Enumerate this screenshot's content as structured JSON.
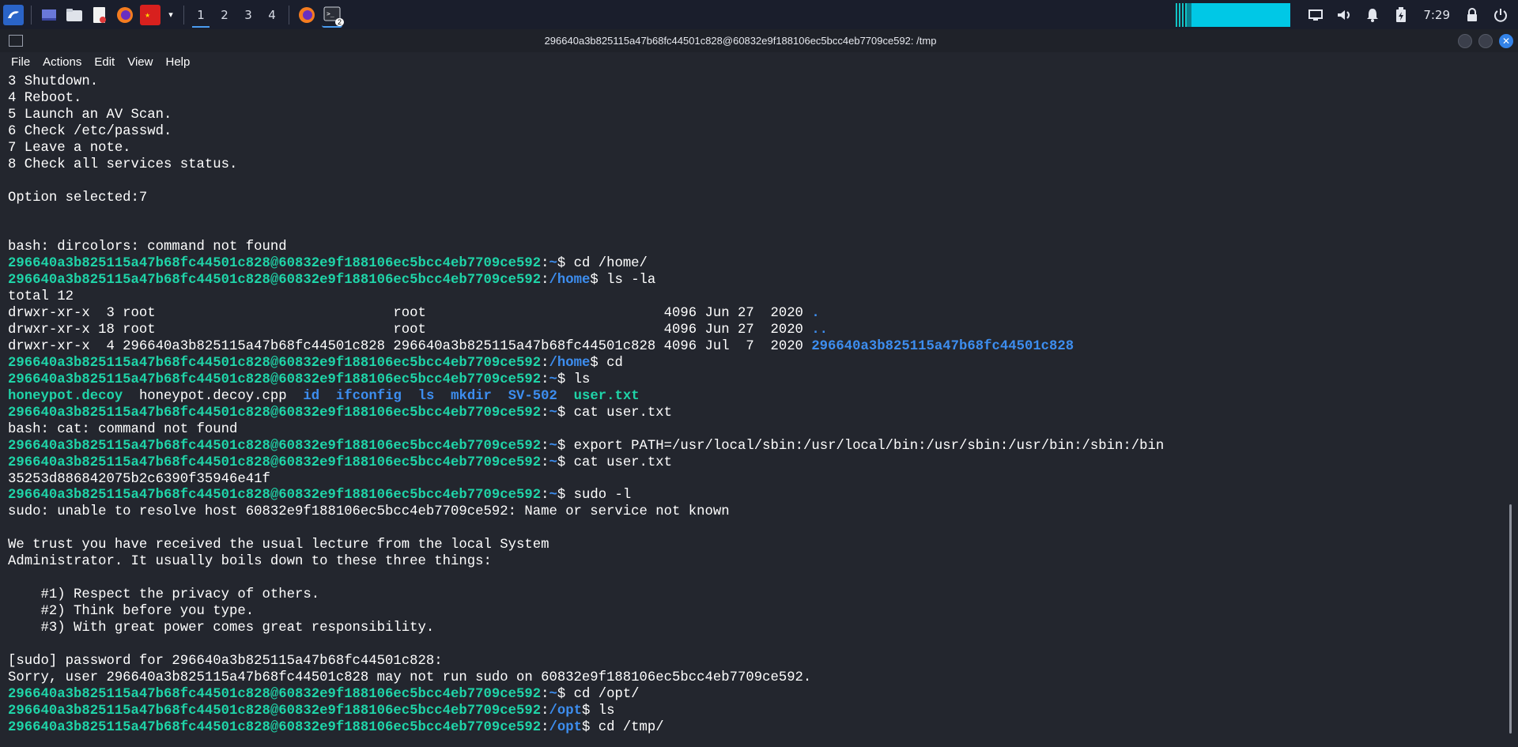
{
  "taskbar": {
    "workspaces": [
      "1",
      "2",
      "3",
      "4"
    ],
    "active_workspace": 0,
    "terminal_badge": "2",
    "clock": "7:29",
    "accent_color": "#4a9cf0"
  },
  "window": {
    "title": "296640a3b825115a47b68fc44501c828@60832e9f188106ec5bcc4eb7709ce592: /tmp"
  },
  "menubar": {
    "items": [
      "File",
      "Actions",
      "Edit",
      "View",
      "Help"
    ]
  },
  "terminal": {
    "user": "296640a3b825115a47b68fc44501c828",
    "host": "60832e9f188106ec5bcc4eb7709ce592",
    "prompt_user_color": "#1fd4a8",
    "prompt_path_color": "#3d8ef0",
    "text_color": "#ffffff",
    "background": "#23262e",
    "lines": [
      {
        "type": "out",
        "text": "3 Shutdown."
      },
      {
        "type": "out",
        "text": "4 Reboot."
      },
      {
        "type": "out",
        "text": "5 Launch an AV Scan."
      },
      {
        "type": "out",
        "text": "6 Check /etc/passwd."
      },
      {
        "type": "out",
        "text": "7 Leave a note."
      },
      {
        "type": "out",
        "text": "8 Check all services status."
      },
      {
        "type": "out",
        "text": ""
      },
      {
        "type": "out",
        "text": "Option selected:7"
      },
      {
        "type": "out",
        "text": ""
      },
      {
        "type": "out",
        "text": ""
      },
      {
        "type": "out",
        "text": "bash: dircolors: command not found"
      },
      {
        "type": "prompt",
        "user": "296640a3b825115a47b68fc44501c828@60832e9f188106ec5bcc4eb7709ce592",
        "path": "~",
        "cmd": "cd /home/"
      },
      {
        "type": "prompt",
        "user": "296640a3b825115a47b68fc44501c828@60832e9f188106ec5bcc4eb7709ce592",
        "path": "/home",
        "cmd": "ls -la"
      },
      {
        "type": "out",
        "text": "total 12"
      },
      {
        "type": "ls",
        "text": "drwxr-xr-x  3 root                             root                             4096 Jun 27  2020 ",
        "name": "."
      },
      {
        "type": "ls",
        "text": "drwxr-xr-x 18 root                             root                             4096 Jun 27  2020 ",
        "name": ".."
      },
      {
        "type": "ls",
        "text": "drwxr-xr-x  4 296640a3b825115a47b68fc44501c828 296640a3b825115a47b68fc44501c828 4096 Jul  7  2020 ",
        "name": "296640a3b825115a47b68fc44501c828"
      },
      {
        "type": "prompt",
        "user": "296640a3b825115a47b68fc44501c828@60832e9f188106ec5bcc4eb7709ce592",
        "path": "/home",
        "cmd": "cd"
      },
      {
        "type": "prompt",
        "user": "296640a3b825115a47b68fc44501c828@60832e9f188106ec5bcc4eb7709ce592",
        "path": "~",
        "cmd": "ls"
      },
      {
        "type": "files",
        "items": [
          {
            "name": "honeypot.decoy",
            "kind": "exec"
          },
          {
            "name": "honeypot.decoy.cpp",
            "kind": "plain"
          },
          {
            "name": "id",
            "kind": "dir"
          },
          {
            "name": "ifconfig",
            "kind": "dir"
          },
          {
            "name": "ls",
            "kind": "dir"
          },
          {
            "name": "mkdir",
            "kind": "dir"
          },
          {
            "name": "SV-502",
            "kind": "dir"
          },
          {
            "name": "user.txt",
            "kind": "exec"
          }
        ]
      },
      {
        "type": "prompt",
        "user": "296640a3b825115a47b68fc44501c828@60832e9f188106ec5bcc4eb7709ce592",
        "path": "~",
        "cmd": "cat user.txt"
      },
      {
        "type": "out",
        "text": "bash: cat: command not found"
      },
      {
        "type": "prompt",
        "user": "296640a3b825115a47b68fc44501c828@60832e9f188106ec5bcc4eb7709ce592",
        "path": "~",
        "cmd": "export PATH=/usr/local/sbin:/usr/local/bin:/usr/sbin:/usr/bin:/sbin:/bin"
      },
      {
        "type": "prompt",
        "user": "296640a3b825115a47b68fc44501c828@60832e9f188106ec5bcc4eb7709ce592",
        "path": "~",
        "cmd": "cat user.txt"
      },
      {
        "type": "out",
        "text": "35253d886842075b2c6390f35946e41f"
      },
      {
        "type": "prompt",
        "user": "296640a3b825115a47b68fc44501c828@60832e9f188106ec5bcc4eb7709ce592",
        "path": "~",
        "cmd": "sudo -l"
      },
      {
        "type": "out",
        "text": "sudo: unable to resolve host 60832e9f188106ec5bcc4eb7709ce592: Name or service not known"
      },
      {
        "type": "out",
        "text": ""
      },
      {
        "type": "out",
        "text": "We trust you have received the usual lecture from the local System"
      },
      {
        "type": "out",
        "text": "Administrator. It usually boils down to these three things:"
      },
      {
        "type": "out",
        "text": ""
      },
      {
        "type": "out",
        "text": "    #1) Respect the privacy of others."
      },
      {
        "type": "out",
        "text": "    #2) Think before you type."
      },
      {
        "type": "out",
        "text": "    #3) With great power comes great responsibility."
      },
      {
        "type": "out",
        "text": ""
      },
      {
        "type": "out",
        "text": "[sudo] password for 296640a3b825115a47b68fc44501c828:"
      },
      {
        "type": "out",
        "text": "Sorry, user 296640a3b825115a47b68fc44501c828 may not run sudo on 60832e9f188106ec5bcc4eb7709ce592."
      },
      {
        "type": "prompt",
        "user": "296640a3b825115a47b68fc44501c828@60832e9f188106ec5bcc4eb7709ce592",
        "path": "~",
        "cmd": "cd /opt/"
      },
      {
        "type": "prompt",
        "user": "296640a3b825115a47b68fc44501c828@60832e9f188106ec5bcc4eb7709ce592",
        "path": "/opt",
        "cmd": "ls"
      },
      {
        "type": "prompt",
        "user": "296640a3b825115a47b68fc44501c828@60832e9f188106ec5bcc4eb7709ce592",
        "path": "/opt",
        "cmd": "cd /tmp/"
      }
    ]
  }
}
